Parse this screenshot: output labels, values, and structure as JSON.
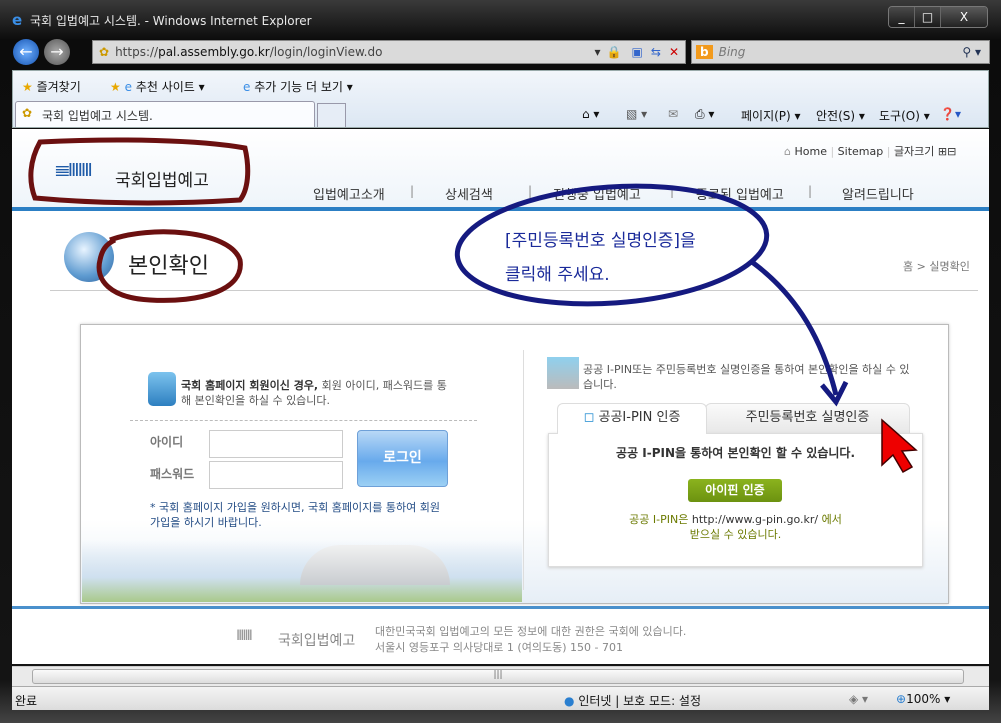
{
  "window": {
    "title": "국회 입법예고 시스템. - Windows Internet Explorer",
    "controls": [
      "_",
      "□",
      "X"
    ]
  },
  "address": {
    "scheme": "https://",
    "host": "pal.assembly.go.kr",
    "path": "/login/loginView.do",
    "search_placeholder": "Bing"
  },
  "favorites": {
    "favorites_label": "즐겨찾기",
    "suggested_sites": "추천 사이트 ▾",
    "more_addons": "추가 기능 더 보기 ▾"
  },
  "tab": {
    "title": "국회 입법예고 시스템."
  },
  "commandbar": {
    "page": "페이지(P) ▾",
    "safety": "안전(S) ▾",
    "tools": "도구(O) ▾"
  },
  "site": {
    "logo": "국회입법예고",
    "top_links": [
      "Home",
      "Sitemap",
      "글자크기"
    ],
    "nav": [
      "입법예고소개",
      "상세검색",
      "진행중 입법예고",
      "종료된 입법예고",
      "알려드립니다"
    ],
    "page_title": "본인확인",
    "breadcrumb": "홈 > 실명확인"
  },
  "annotation": {
    "line1": "[주민등록번호 실명인증]을",
    "line2": "클릭해 주세요."
  },
  "login": {
    "intro_bold": "국회 홈페이지 회원이신 경우,",
    "intro_rest": " 회원 아이디, 패스워드를 통해 본인확인을 하실 수 있습니다.",
    "id_label": "아이디",
    "pw_label": "패스워드",
    "id_value": "",
    "pw_value": "",
    "login_button": "로그인",
    "signup_note": "* 국회 홈페이지 가입을 원하시면, 국회 홈페이지를 통하여 회원가입을 하시기 바랍니다."
  },
  "verify": {
    "intro": "공공 I-PIN또는 주민등록번호 실명인증을 통하여 본인확인을 하실 수 있습니다.",
    "tabs": [
      "공공I-PIN 인증",
      "주민등록번호 실명인증"
    ],
    "panel_text": "공공 I-PIN을 통하여 본인확인 할 수 있습니다.",
    "ipin_button": "아이핀 인증",
    "note_a": "공공 I-PIN은 ",
    "note_url": "http://www.g-pin.go.kr/",
    "note_b": " 에서",
    "note_c": "받으실 수 있습니다."
  },
  "footer": {
    "logo": "국회입법예고",
    "line1": "대한민국국회 입법예고의 모든 정보에 대한 권한은 국회에 있습니다.",
    "line2": "서울시 영등포구 의사당대로 1 (여의도동) 150 - 701"
  },
  "statusbar": {
    "text": "완료",
    "zone": "인터넷 | 보호 모드: 설정",
    "zoom": "100%"
  }
}
